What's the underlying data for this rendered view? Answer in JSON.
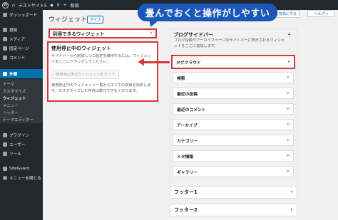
{
  "adminbar": {
    "site_name": "テストサイト5",
    "comments_count": "0",
    "new_label": "新規"
  },
  "sidebar": {
    "items": [
      {
        "label": "ダッシュボード",
        "icon": "dashboard-icon"
      },
      {
        "label": "投稿",
        "icon": "pin-icon"
      },
      {
        "label": "メディア",
        "icon": "media-icon"
      },
      {
        "label": "固定ページ",
        "icon": "page-icon"
      },
      {
        "label": "コメント",
        "icon": "comment-icon"
      },
      {
        "label": "外観",
        "icon": "brush-icon"
      },
      {
        "label": "プラグイン",
        "icon": "plugin-icon"
      },
      {
        "label": "ユーザー",
        "icon": "user-icon"
      },
      {
        "label": "ツール",
        "icon": "wrench-icon"
      },
      {
        "label": "SiteGuard",
        "icon": "shield-icon"
      },
      {
        "label": "メニューを閉じる",
        "icon": "collapse-icon"
      }
    ],
    "submenu": [
      "テーマ",
      "カスタマイズ",
      "ウィジェット",
      "メニュー",
      "ヘッダー",
      "テーマエディター"
    ]
  },
  "header": {
    "title": "ウィジェット",
    "live_preview": "ライブ",
    "accessibility_link": "ィモードを有効にする",
    "help": "ヘルプ ▾"
  },
  "callout": "畳んでおくと操作がしやすい",
  "available": {
    "title": "利用できるウィジェット"
  },
  "inactive": {
    "title": "使用停止中のウィジェット",
    "desc": "サイドバーから削除しつつ設定を維持するには、ウィジェットをここにドラッグしてください。",
    "clear_button": "使用停止中のウィジェットをクリア",
    "note": "使用停止中のウィジェット一覧からすべての項目を消去します。カスタマイズした内容は復元できなくなります。"
  },
  "blog_sidebar": {
    "title": "ブログサイドバー",
    "desc": "ブログ投稿やアーカイブページのサイドバーに表示されるウィジェットをここに追加します。",
    "widgets": [
      "タグクラウド",
      "検索",
      "最近の投稿",
      "最近のコメント",
      "アーカイブ",
      "カテゴリー",
      "メタ情報",
      "ギャラリー"
    ]
  },
  "footers": [
    "フッター1",
    "フッター2"
  ],
  "colors": {
    "admin_dark": "#23282d",
    "accent": "#0073aa",
    "highlight_red": "#d63638",
    "callout_blue": "#1a57b8"
  }
}
